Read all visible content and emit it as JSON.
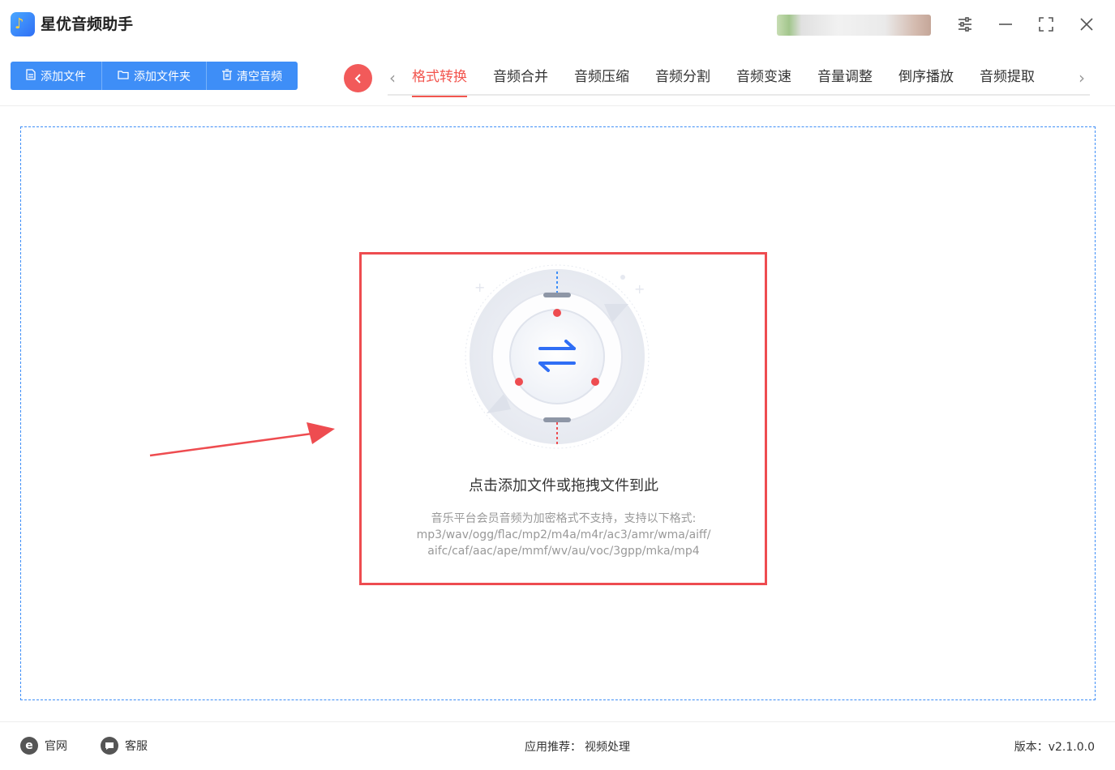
{
  "app": {
    "title": "星优音频助手"
  },
  "toolbar": {
    "add_file": "添加文件",
    "add_folder": "添加文件夹",
    "clear": "清空音频"
  },
  "tabs": [
    {
      "label": "格式转换",
      "active": true
    },
    {
      "label": "音频合并"
    },
    {
      "label": "音频压缩"
    },
    {
      "label": "音频分割"
    },
    {
      "label": "音频变速"
    },
    {
      "label": "音量调整"
    },
    {
      "label": "倒序播放"
    },
    {
      "label": "音频提取"
    }
  ],
  "dropzone": {
    "title": "点击添加文件或拖拽文件到此",
    "hint_line1": "音乐平台会员音频为加密格式不支持，支持以下格式:",
    "hint_line2": "mp3/wav/ogg/flac/mp2/m4a/m4r/ac3/amr/wma/aiff/",
    "hint_line3": "aifc/caf/aac/ape/mmf/wv/au/voc/3gpp/mka/mp4"
  },
  "footer": {
    "website": "官网",
    "support": "客服",
    "recommend_label": "应用推荐：",
    "recommend_link": "视频处理",
    "version": "版本：v2.1.0.0"
  },
  "colors": {
    "accent": "#3e8ef7",
    "active_tab": "#f2554e",
    "highlight": "#ee4c50"
  }
}
